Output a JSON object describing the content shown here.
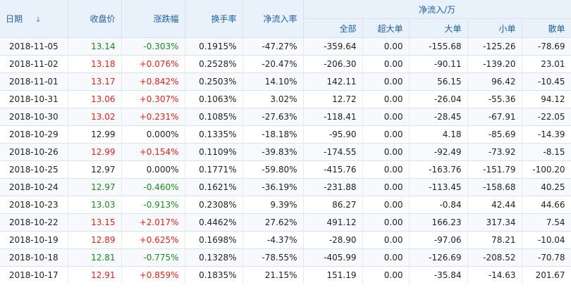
{
  "headers": {
    "date": "日期",
    "close": "收盘价",
    "change_pct": "涨跌幅",
    "turnover": "换手率",
    "net_inflow_rate": "净流入率",
    "net_inflow_group": "净流入/万",
    "all": "全部",
    "super_large": "超大单",
    "large": "大单",
    "small": "小单",
    "retail": "散单",
    "sort_icon": "↓"
  },
  "rows": [
    {
      "date": "2018-11-05",
      "close": "13.14",
      "change": "-0.303%",
      "turnover": "0.1915%",
      "rate": "-47.27%",
      "all": "-359.64",
      "superlarge": "0.00",
      "large": "-155.68",
      "small": "-125.26",
      "retail": "-78.69",
      "dir": "down"
    },
    {
      "date": "2018-11-02",
      "close": "13.18",
      "change": "+0.076%",
      "turnover": "0.2528%",
      "rate": "-20.47%",
      "all": "-206.30",
      "superlarge": "0.00",
      "large": "-90.11",
      "small": "-139.20",
      "retail": "23.01",
      "dir": "up"
    },
    {
      "date": "2018-11-01",
      "close": "13.17",
      "change": "+0.842%",
      "turnover": "0.2503%",
      "rate": "14.10%",
      "all": "142.11",
      "superlarge": "0.00",
      "large": "56.15",
      "small": "96.42",
      "retail": "-10.45",
      "dir": "up"
    },
    {
      "date": "2018-10-31",
      "close": "13.06",
      "change": "+0.307%",
      "turnover": "0.1063%",
      "rate": "3.02%",
      "all": "12.72",
      "superlarge": "0.00",
      "large": "-26.04",
      "small": "-55.36",
      "retail": "94.12",
      "dir": "up"
    },
    {
      "date": "2018-10-30",
      "close": "13.02",
      "change": "+0.231%",
      "turnover": "0.1085%",
      "rate": "-27.63%",
      "all": "-118.41",
      "superlarge": "0.00",
      "large": "-28.45",
      "small": "-67.91",
      "retail": "-22.05",
      "dir": "up"
    },
    {
      "date": "2018-10-29",
      "close": "12.99",
      "change": "0.000%",
      "turnover": "0.1335%",
      "rate": "-18.18%",
      "all": "-95.90",
      "superlarge": "0.00",
      "large": "4.18",
      "small": "-85.69",
      "retail": "-14.39",
      "dir": "flat"
    },
    {
      "date": "2018-10-26",
      "close": "12.99",
      "change": "+0.154%",
      "turnover": "0.1109%",
      "rate": "-39.83%",
      "all": "-174.55",
      "superlarge": "0.00",
      "large": "-92.49",
      "small": "-73.92",
      "retail": "-8.15",
      "dir": "up"
    },
    {
      "date": "2018-10-25",
      "close": "12.97",
      "change": "0.000%",
      "turnover": "0.1771%",
      "rate": "-59.80%",
      "all": "-415.76",
      "superlarge": "0.00",
      "large": "-163.76",
      "small": "-151.79",
      "retail": "-100.20",
      "dir": "flat"
    },
    {
      "date": "2018-10-24",
      "close": "12.97",
      "change": "-0.460%",
      "turnover": "0.1621%",
      "rate": "-36.19%",
      "all": "-231.88",
      "superlarge": "0.00",
      "large": "-113.45",
      "small": "-158.68",
      "retail": "40.25",
      "dir": "down"
    },
    {
      "date": "2018-10-23",
      "close": "13.03",
      "change": "-0.913%",
      "turnover": "0.2308%",
      "rate": "9.39%",
      "all": "86.27",
      "superlarge": "0.00",
      "large": "-0.84",
      "small": "42.44",
      "retail": "44.66",
      "dir": "down"
    },
    {
      "date": "2018-10-22",
      "close": "13.15",
      "change": "+2.017%",
      "turnover": "0.4462%",
      "rate": "27.62%",
      "all": "491.12",
      "superlarge": "0.00",
      "large": "166.23",
      "small": "317.34",
      "retail": "7.54",
      "dir": "up"
    },
    {
      "date": "2018-10-19",
      "close": "12.89",
      "change": "+0.625%",
      "turnover": "0.1698%",
      "rate": "-4.37%",
      "all": "-28.90",
      "superlarge": "0.00",
      "large": "-97.06",
      "small": "78.21",
      "retail": "-10.04",
      "dir": "up"
    },
    {
      "date": "2018-10-18",
      "close": "12.81",
      "change": "-0.775%",
      "turnover": "0.1328%",
      "rate": "-78.55%",
      "all": "-405.99",
      "superlarge": "0.00",
      "large": "-126.69",
      "small": "-208.52",
      "retail": "-70.78",
      "dir": "down"
    },
    {
      "date": "2018-10-17",
      "close": "12.91",
      "change": "+0.859%",
      "turnover": "0.1835%",
      "rate": "21.15%",
      "all": "151.19",
      "superlarge": "0.00",
      "large": "-35.84",
      "small": "-14.63",
      "retail": "201.67",
      "dir": "up"
    }
  ]
}
